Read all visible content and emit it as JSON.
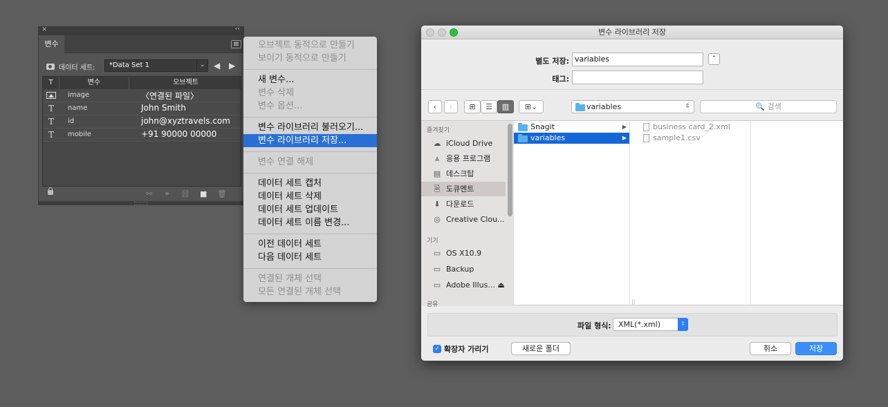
{
  "panel": {
    "close_glyph": "×",
    "collapse_glyph": "‹‹",
    "tab_label": "변수",
    "dataset_label": "데이터 세트:",
    "dataset_value": "*Data Set 1",
    "columns": {
      "type": "T",
      "variable": "변수",
      "object": "오브젝트"
    },
    "rows": [
      {
        "icon": "image-icon",
        "type_glyph": "",
        "name": "image",
        "object": "〈연결된 파일〉"
      },
      {
        "icon": "text-icon",
        "type_glyph": "T",
        "name": "name",
        "object": "John Smith"
      },
      {
        "icon": "text-icon",
        "type_glyph": "T",
        "name": "id",
        "object": "john@xyztravels.com"
      },
      {
        "icon": "text-icon",
        "type_glyph": "T",
        "name": "mobile",
        "object": "+91 90000 00000"
      }
    ]
  },
  "menu": {
    "items": [
      {
        "label": "오브젝트 동적으로 만들기",
        "disabled": true
      },
      {
        "label": "보이기 동적으로 만들기",
        "disabled": true
      },
      {
        "label": "새 변수...",
        "disabled": false
      },
      {
        "label": "변수 삭제",
        "disabled": true
      },
      {
        "label": "변수 옵션...",
        "disabled": true
      },
      {
        "label": "변수 라이브러리 불러오기...",
        "disabled": false
      },
      {
        "label": "변수 라이브러리 저장...",
        "disabled": false,
        "selected": true
      },
      {
        "label": "변수 연결 해제",
        "disabled": true
      },
      {
        "label": "데이터 세트 캡처",
        "disabled": false
      },
      {
        "label": "데이터 세트 삭제",
        "disabled": false
      },
      {
        "label": "데이터 세트 업데이트",
        "disabled": false
      },
      {
        "label": "데이터 세트 이름 변경...",
        "disabled": false
      },
      {
        "label": "이전 데이터 세트",
        "disabled": false
      },
      {
        "label": "다음 데이터 세트",
        "disabled": false
      },
      {
        "label": "연결된 개체 선택",
        "disabled": true
      },
      {
        "label": "모든 연결된 개체 선택",
        "disabled": true
      }
    ]
  },
  "dialog": {
    "title": "변수 라이브러리 저장",
    "save_as_label": "별도 저장:",
    "save_as_value": "variables",
    "tags_label": "태그:",
    "tags_value": "",
    "location": "variables",
    "search_placeholder": "🔍 검색",
    "sidebar": {
      "favorites_header": "즐겨찾기",
      "favorites": [
        {
          "label": "iCloud Drive",
          "icon": "cloud-icon"
        },
        {
          "label": "응용 프로그램",
          "icon": "applications-icon"
        },
        {
          "label": "데스크탑",
          "icon": "desktop-icon"
        },
        {
          "label": "도큐멘트",
          "icon": "documents-icon",
          "selected": true
        },
        {
          "label": "다운로드",
          "icon": "downloads-icon"
        },
        {
          "label": "Creative Clou...",
          "icon": "creative-cloud-icon"
        }
      ],
      "devices_header": "기기",
      "devices": [
        {
          "label": "OS X10.9",
          "icon": "disk-icon"
        },
        {
          "label": "Backup",
          "icon": "disk-icon"
        },
        {
          "label": "Adobe Illus... ⏏",
          "icon": "disk-icon"
        }
      ],
      "shared_header": "공유"
    },
    "column1": [
      {
        "label": "Snagit",
        "selected": false
      },
      {
        "label": "variables",
        "selected": true
      }
    ],
    "column2": [
      {
        "label": "business card_2.xml"
      },
      {
        "label": "sample1.csv"
      }
    ],
    "format_label": "파일 형식:",
    "format_value": "XML(*.xml)",
    "hide_ext_label": "확장자 가리기",
    "new_folder_label": "새로운 폴더",
    "cancel_label": "취소",
    "save_label": "저장",
    "accent": "#3b8ff7",
    "selection": "#1467d8"
  }
}
